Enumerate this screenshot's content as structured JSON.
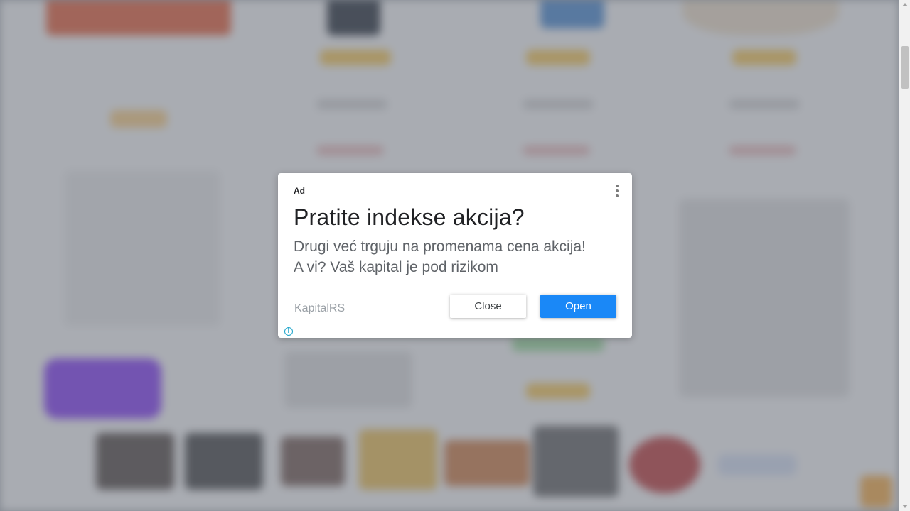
{
  "ad": {
    "label": "Ad",
    "title": "Pratite indekse akcija?",
    "body": "Drugi već trguju na promenama cena akcija! A vi? Vaš kapital je pod rizikom",
    "advertiser": "KapitalRS",
    "close_label": "Close",
    "open_label": "Open",
    "info_glyph": "i",
    "menu_icon": "more-vertical-icon",
    "colors": {
      "open_button": "#1a88f7",
      "info_icon": "#1aa3c9"
    }
  }
}
